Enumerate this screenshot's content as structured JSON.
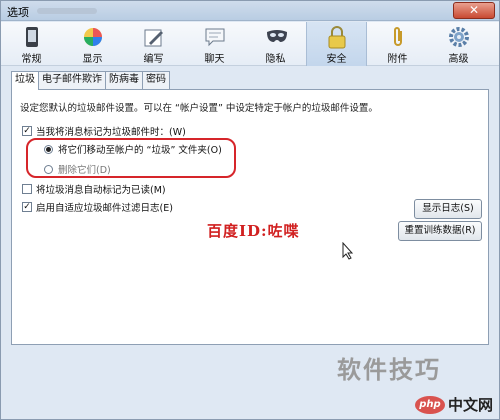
{
  "window": {
    "title": "选项"
  },
  "toolbar": {
    "items": [
      {
        "label": "常规",
        "icon": "phone-icon"
      },
      {
        "label": "显示",
        "icon": "display-icon"
      },
      {
        "label": "编写",
        "icon": "compose-icon"
      },
      {
        "label": "聊天",
        "icon": "chat-icon"
      },
      {
        "label": "隐私",
        "icon": "mask-icon"
      },
      {
        "label": "安全",
        "icon": "lock-icon"
      },
      {
        "label": "附件",
        "icon": "paperclip-icon"
      },
      {
        "label": "高级",
        "icon": "gear-icon"
      }
    ],
    "active_index": 5
  },
  "tabs": [
    {
      "label": "垃圾"
    },
    {
      "label": "电子邮件欺诈"
    },
    {
      "label": "防病毒"
    },
    {
      "label": "密码"
    }
  ],
  "panel": {
    "description": "设定您默认的垃圾邮件设置。可以在 “帐户设置” 中设定特定于帐户的垃圾邮件设置。",
    "opt_mark_when": "当我将消息标记为垃圾邮件时：(W)",
    "opt_move": "将它们移动至帐户的 “垃圾” 文件夹(O)",
    "opt_delete": "删除它们(D)",
    "opt_mark_read": "将垃圾消息自动标记为已读(M)",
    "opt_adaptive_log": "启用自适应垃圾邮件过滤日志(E)",
    "btn_show_log": "显示日志(S)",
    "btn_reset_data": "重置训练数据(R)"
  },
  "overlay": {
    "baidu_id": "百度ID:咗喋",
    "site_watermark": "软件技巧",
    "php_logo": "php",
    "php_site": "中文网"
  },
  "colors": {
    "highlight": "#d6252a",
    "accent": "#c3d6ec"
  }
}
